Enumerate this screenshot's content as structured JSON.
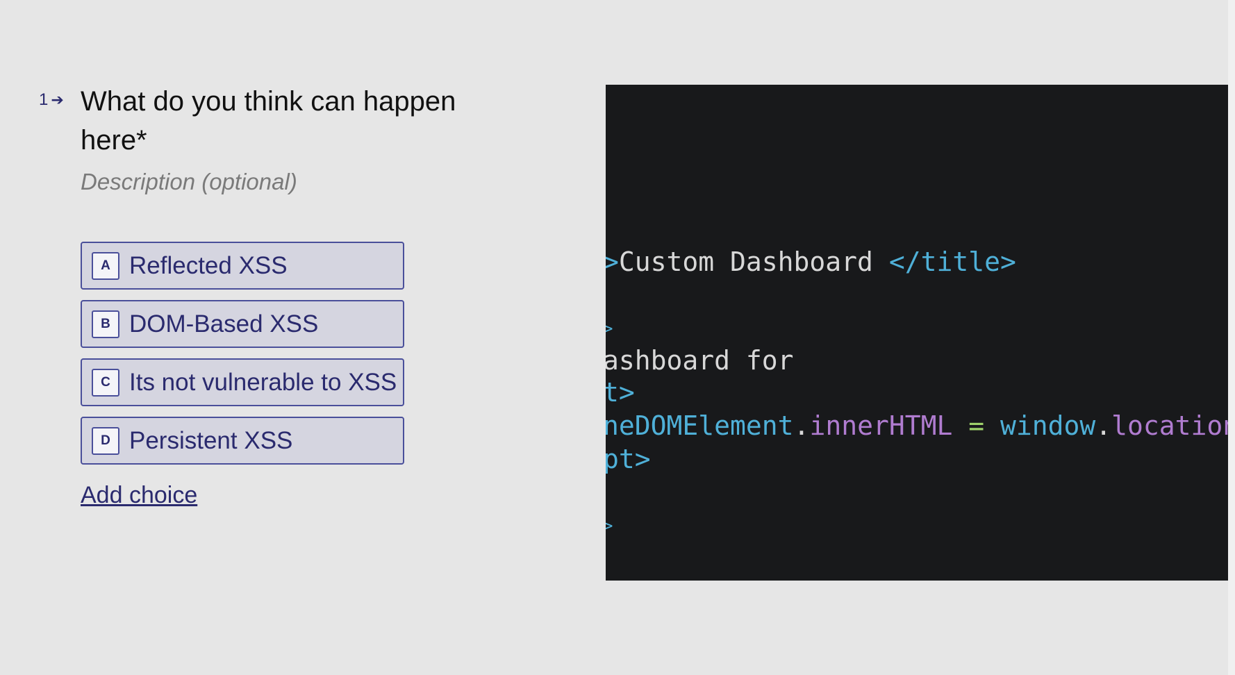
{
  "question": {
    "number": "1",
    "arrow_icon": "arrow-right-icon",
    "title": "What do you think can happen here*",
    "description_placeholder": "Description (optional)"
  },
  "choices": [
    {
      "key": "A",
      "label": "Reflected XSS"
    },
    {
      "key": "B",
      "label": "DOM-Based XSS"
    },
    {
      "key": "C",
      "label": "Its not vulnerable to XSS"
    },
    {
      "key": "D",
      "label": "Persistent XSS"
    }
  ],
  "add_choice_label": "Add choice",
  "code_image": {
    "line1": {
      "a": ">",
      "b": "Custom Dashboard ",
      "c": "</title>"
    },
    "line2": {
      "a": ">"
    },
    "line3": {
      "a": "ashboard for"
    },
    "line4": {
      "a": "t>"
    },
    "line5": {
      "a": "neDOMElement",
      "b": ".",
      "c": "innerHTML",
      "d": " = ",
      "e": "window",
      "f": ".",
      "g": "location",
      "h": "."
    },
    "line6": {
      "a": "pt>"
    },
    "line7": {
      "a": ">"
    }
  },
  "colors": {
    "background": "#e6e6e6",
    "accent": "#2a2a6e",
    "choice_bg": "#d5d5e0",
    "code_bg": "#18191b",
    "code_tag": "#4fb0d8",
    "code_prop": "#b07cd0"
  }
}
